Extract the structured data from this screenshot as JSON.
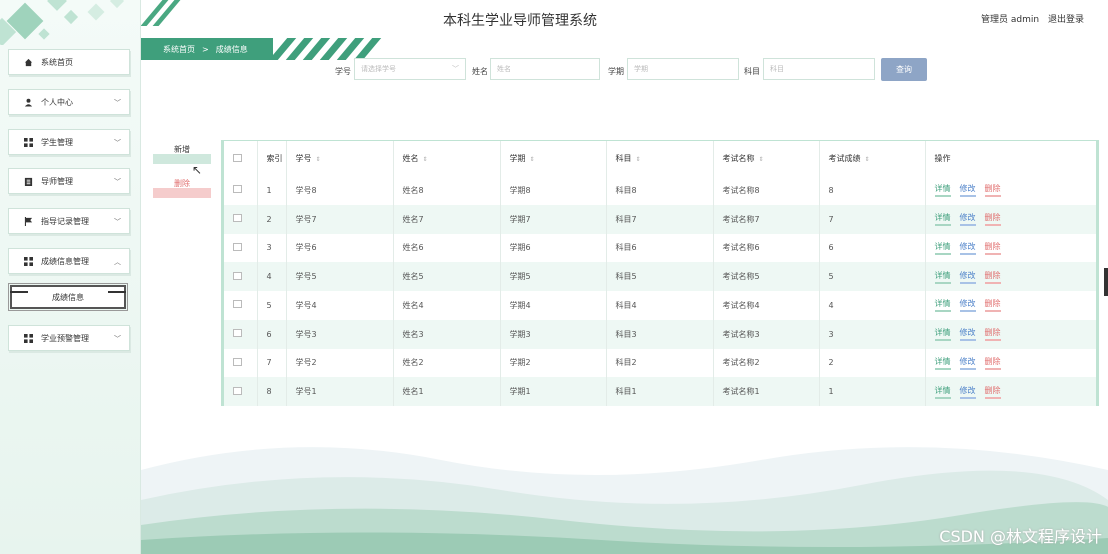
{
  "app": {
    "title": "本科生学业导师管理系统",
    "user_label": "管理员 admin",
    "logout_label": "退出登录"
  },
  "sidebar": {
    "items": [
      {
        "label": "系统首页",
        "icon": "home-icon",
        "expanded": false,
        "has_chevron": false
      },
      {
        "label": "个人中心",
        "icon": "user-icon",
        "has_chevron": true
      },
      {
        "label": "学生管理",
        "icon": "grid-icon",
        "has_chevron": true
      },
      {
        "label": "导师管理",
        "icon": "clipboard-icon",
        "has_chevron": true
      },
      {
        "label": "指导记录管理",
        "icon": "flag-icon",
        "has_chevron": true
      },
      {
        "label": "成绩信息管理",
        "icon": "grid-icon",
        "has_chevron": true,
        "expanded": true
      },
      {
        "label": "学业预警管理",
        "icon": "grid-icon",
        "has_chevron": true
      }
    ],
    "sub_item": {
      "label": "成绩信息"
    }
  },
  "breadcrumb": {
    "home": "系统首页",
    "separator": ">",
    "current": "成绩信息"
  },
  "search": {
    "xuehao_label": "学号",
    "xuehao_placeholder": "请选择学号",
    "name_label": "姓名",
    "name_placeholder": "姓名",
    "term_label": "学期",
    "term_placeholder": "学期",
    "subject_label": "科目",
    "subject_placeholder": "科目",
    "query_label": "查询"
  },
  "actions": {
    "add_label": "新增",
    "delete_label": "删除"
  },
  "table": {
    "headers": [
      "索引",
      "学号",
      "姓名",
      "学期",
      "科目",
      "考试名称",
      "考试成绩",
      "操作"
    ],
    "action_labels": {
      "detail": "详情",
      "edit": "修改",
      "delete": "删除"
    },
    "rows": [
      {
        "idx": "1",
        "xuehao": "学号8",
        "name": "姓名8",
        "term": "学期8",
        "subject": "科目8",
        "exam": "考试名称8",
        "score": "8"
      },
      {
        "idx": "2",
        "xuehao": "学号7",
        "name": "姓名7",
        "term": "学期7",
        "subject": "科目7",
        "exam": "考试名称7",
        "score": "7"
      },
      {
        "idx": "3",
        "xuehao": "学号6",
        "name": "姓名6",
        "term": "学期6",
        "subject": "科目6",
        "exam": "考试名称6",
        "score": "6"
      },
      {
        "idx": "4",
        "xuehao": "学号5",
        "name": "姓名5",
        "term": "学期5",
        "subject": "科目5",
        "exam": "考试名称5",
        "score": "5"
      },
      {
        "idx": "5",
        "xuehao": "学号4",
        "name": "姓名4",
        "term": "学期4",
        "subject": "科目4",
        "exam": "考试名称4",
        "score": "4"
      },
      {
        "idx": "6",
        "xuehao": "学号3",
        "name": "姓名3",
        "term": "学期3",
        "subject": "科目3",
        "exam": "考试名称3",
        "score": "3"
      },
      {
        "idx": "7",
        "xuehao": "学号2",
        "name": "姓名2",
        "term": "学期2",
        "subject": "科目2",
        "exam": "考试名称2",
        "score": "2"
      },
      {
        "idx": "8",
        "xuehao": "学号1",
        "name": "姓名1",
        "term": "学期1",
        "subject": "科目1",
        "exam": "考试名称1",
        "score": "1"
      }
    ]
  },
  "watermark": "CSDN @林文程序设计",
  "colors": {
    "accent": "#3f9f7c",
    "query_button": "#8ea5c6",
    "row_stripe": "#eef8f4",
    "delete": "#e06c6c",
    "edit": "#4a7fc8"
  }
}
